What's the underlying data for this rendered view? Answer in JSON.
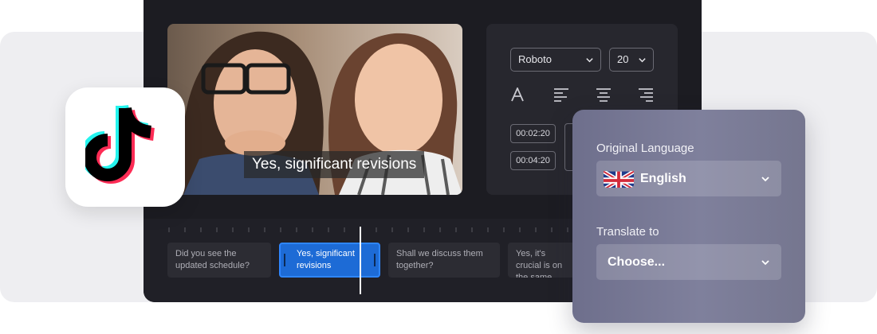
{
  "video": {
    "subtitle_overlay": "Yes, significant revisions"
  },
  "style_panel": {
    "font_family": "Roboto",
    "font_size": "20",
    "text_icon": "text-style-icon",
    "alignment_icons": [
      "align-left-icon",
      "align-center-icon",
      "align-right-icon"
    ],
    "timecodes": [
      "00:02:20",
      "00:04:20"
    ]
  },
  "timeline": {
    "clips": [
      "Did you see the updated schedule?",
      "Yes, significant revisions",
      "Shall we discuss them together?",
      "Yes, it's crucial is on the same"
    ],
    "active_clip_index": 1
  },
  "app_icon": {
    "name": "tiktok-logo",
    "colors": {
      "cyan": "#25F4EE",
      "pink": "#FE2C55",
      "black": "#000000"
    }
  },
  "translate_card": {
    "original_language_label": "Original Language",
    "original_language_value": "English",
    "translate_to_label": "Translate to",
    "translate_to_value": "Choose..."
  },
  "colors": {
    "editor_bg": "#1c1c22",
    "accent_blue": "#1d6bd6",
    "card_bg": "#7f809c"
  }
}
